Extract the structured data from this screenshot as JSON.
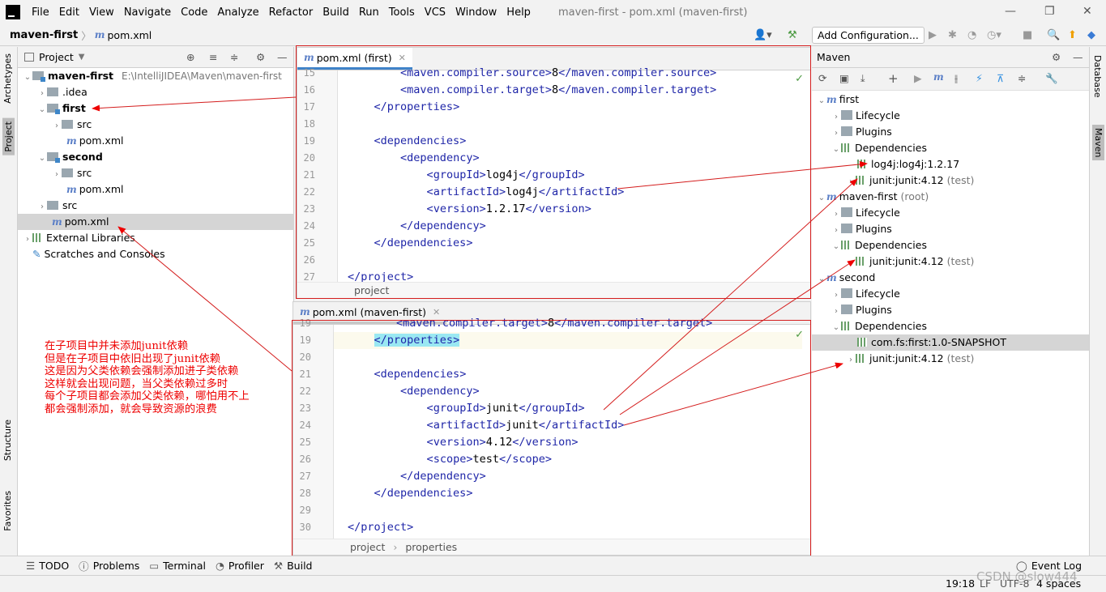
{
  "menu": {
    "items": [
      "File",
      "Edit",
      "View",
      "Navigate",
      "Code",
      "Analyze",
      "Refactor",
      "Build",
      "Run",
      "Tools",
      "VCS",
      "Window",
      "Help"
    ],
    "window_title": "maven-first - pom.xml (maven-first)"
  },
  "nav": {
    "project": "maven-first",
    "file": "pom.xml",
    "add_config": "Add Configuration..."
  },
  "left_tabs": {
    "archetypes": "Archetypes",
    "project": "Project",
    "structure": "Structure",
    "favorites": "Favorites"
  },
  "right_tabs": {
    "database": "Database",
    "maven": "Maven"
  },
  "project_panel": {
    "title": "Project",
    "root": "maven-first",
    "root_path": "E:\\IntelliJIDEA\\Maven\\maven-first",
    "idea": ".idea",
    "first": "first",
    "src": "src",
    "pom": "pom.xml",
    "second": "second",
    "external": "External Libraries",
    "scratches": "Scratches and Consoles"
  },
  "editor_top": {
    "tab": "pom.xml (first)",
    "lines": [
      "15",
      "16",
      "17",
      "18",
      "19",
      "20",
      "21",
      "22",
      "23",
      "24",
      "25",
      "26",
      "27"
    ],
    "code": {
      "l15": "maven.compiler.source",
      "l15v": "8",
      "l16": "maven.compiler.target",
      "l16v": "8",
      "properties": "properties",
      "dependencies": "dependencies",
      "dependency": "dependency",
      "groupId": "groupId",
      "artifactId": "artifactId",
      "version": "version",
      "g": "log4j",
      "a": "log4j",
      "v": "1.2.17",
      "project": "project"
    },
    "footer": "project"
  },
  "editor_bottom": {
    "tab": "pom.xml (maven-first)",
    "lines": [
      "19",
      "20",
      "21",
      "22",
      "23",
      "24",
      "25",
      "26",
      "27",
      "28",
      "29",
      "30"
    ],
    "code": {
      "properties": "properties",
      "dependencies": "dependencies",
      "dependency": "dependency",
      "groupId": "groupId",
      "artifactId": "artifactId",
      "version": "version",
      "scope": "scope",
      "g": "junit",
      "a": "junit",
      "v": "4.12",
      "s": "test",
      "project": "project",
      "top": "maven.compiler.target",
      "topv": "8"
    },
    "footer_a": "project",
    "footer_b": "properties"
  },
  "maven": {
    "title": "Maven",
    "first": "first",
    "lifecycle": "Lifecycle",
    "plugins": "Plugins",
    "dependencies": "Dependencies",
    "log4j": "log4j:log4j:1.2.17",
    "junit": "junit:junit:4.12",
    "test": "(test)",
    "mavenfirst": "maven-first",
    "root": "(root)",
    "second": "second",
    "snapshot": "com.fs:first:1.0-SNAPSHOT"
  },
  "annotation": [
    "在子项目中并未添加junit依赖",
    "但是在子项目中依旧出现了junit依赖",
    "这是因为父类依赖会强制添加进子类依赖",
    "这样就会出现问题，当父类依赖过多时",
    "每个子项目都会添加父类依赖，哪怕用不上",
    "都会强制添加，就会导致资源的浪费"
  ],
  "bottom_tabs": {
    "todo": "TODO",
    "problems": "Problems",
    "terminal": "Terminal",
    "profiler": "Profiler",
    "build": "Build",
    "event_log": "Event Log"
  },
  "status": {
    "position": "19:18",
    "lf": "LF",
    "encoding": "UTF-8",
    "indent": "4 spaces",
    "watermark": "CSDN @slow444"
  },
  "colors": {
    "tag": "#1f26a8",
    "annotation": "#e00000",
    "accent": "#4083c9"
  }
}
